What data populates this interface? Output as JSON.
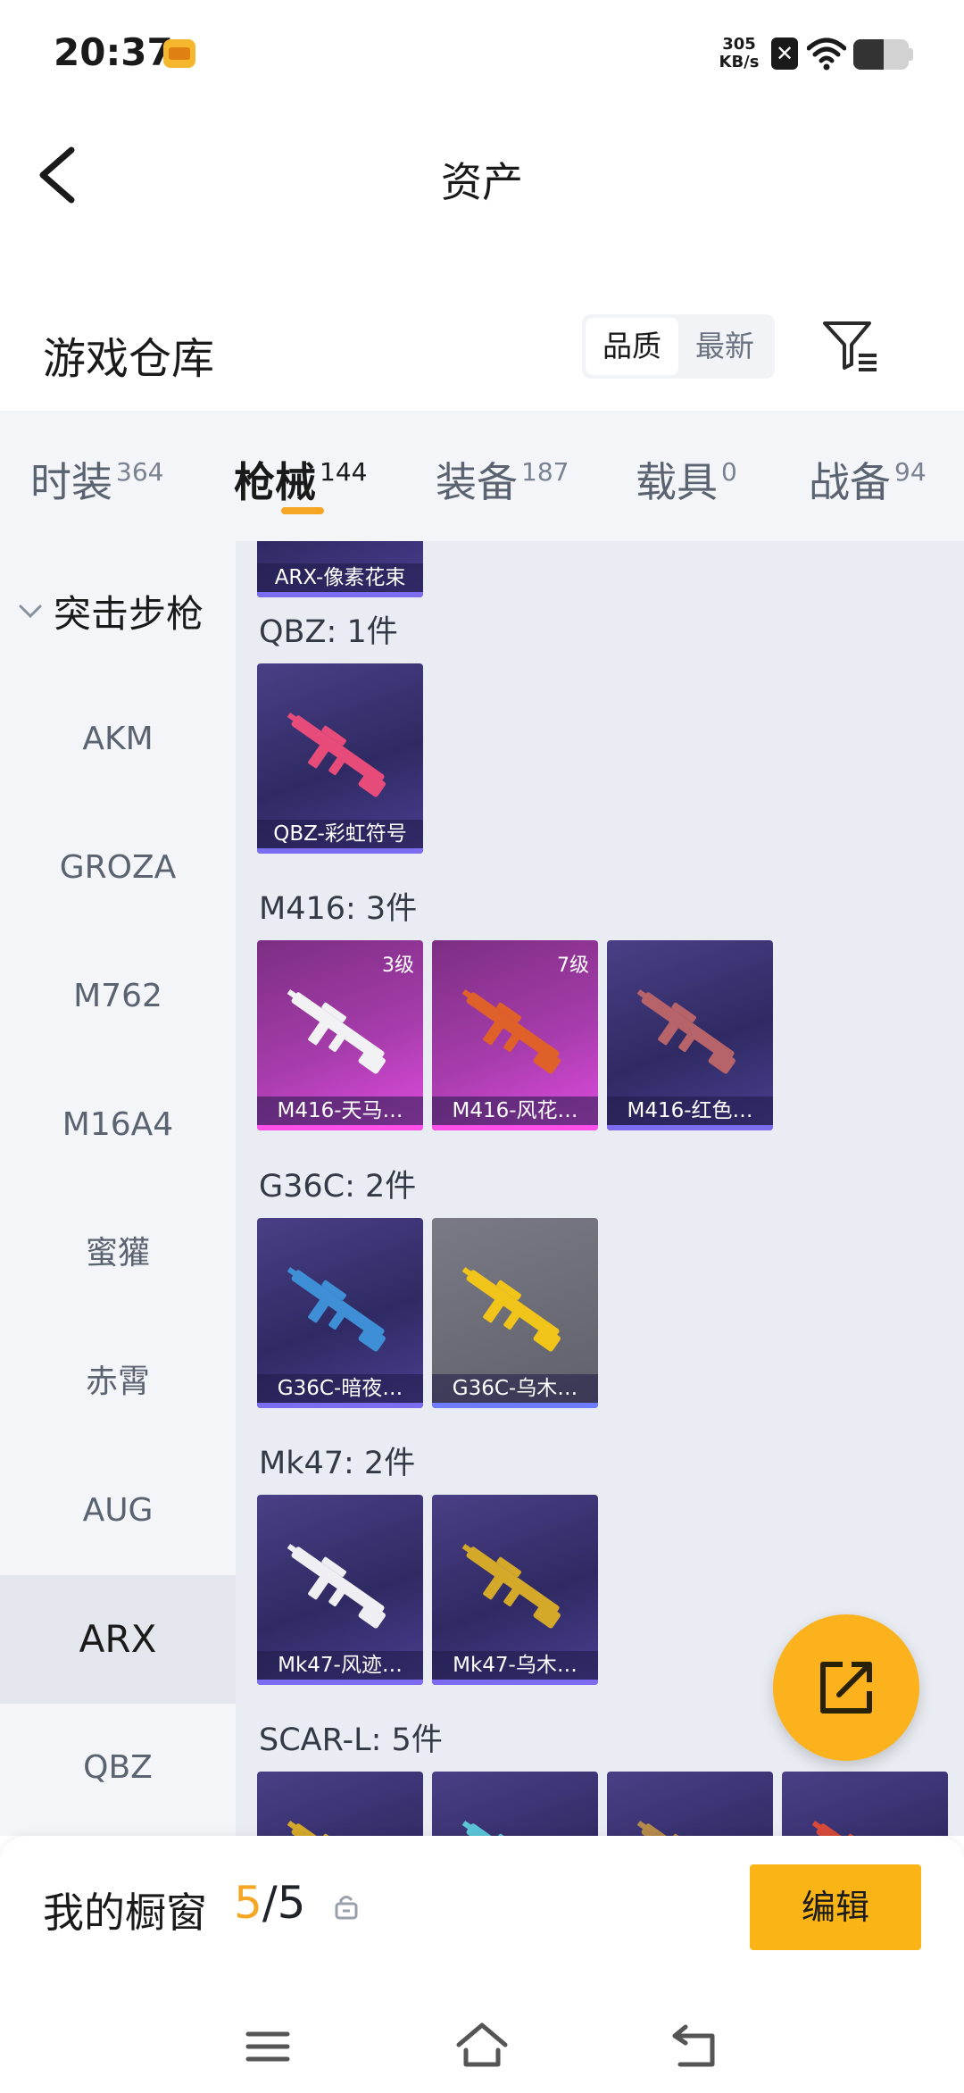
{
  "status_bar": {
    "time": "20:37",
    "net_speed_value": "305",
    "net_speed_unit": "KB/s",
    "battery_level": 0.55
  },
  "header": {
    "title": "资产"
  },
  "warehouse": {
    "title": "游戏仓库",
    "sort_options": [
      "品质",
      "最新"
    ],
    "sort_active": "品质"
  },
  "tabs": [
    {
      "label": "时装",
      "count": "364",
      "active": false
    },
    {
      "label": "枪械",
      "count": "144",
      "active": true
    },
    {
      "label": "装备",
      "count": "187",
      "active": false
    },
    {
      "label": "载具",
      "count": "0",
      "active": false
    },
    {
      "label": "战备",
      "count": "94",
      "active": false
    }
  ],
  "sidebar": {
    "group": "突击步枪",
    "items": [
      "AKM",
      "GROZA",
      "M762",
      "M16A4",
      "蜜獾",
      "赤霄",
      "AUG",
      "ARX",
      "QBZ"
    ],
    "active": "ARX"
  },
  "content": {
    "partial_card": "ARX-像素花束",
    "groups": [
      {
        "title": "QBZ: 1件",
        "items": [
          {
            "name": "QBZ-彩虹符号",
            "level": "",
            "style": "purple",
            "gun_color": "#e64b7a"
          }
        ]
      },
      {
        "title": "M416: 3件",
        "items": [
          {
            "name": "M416-天马…",
            "level": "3级",
            "style": "pink",
            "gun_color": "#f2f2f5"
          },
          {
            "name": "M416-风花…",
            "level": "7级",
            "style": "pink",
            "gun_color": "#e0602a"
          },
          {
            "name": "M416-红色…",
            "level": "",
            "style": "purple",
            "gun_color": "#b7636a"
          }
        ]
      },
      {
        "title": "G36C: 2件",
        "items": [
          {
            "name": "G36C-暗夜…",
            "level": "",
            "style": "purple",
            "gun_color": "#3f8fd6"
          },
          {
            "name": "G36C-乌木…",
            "level": "",
            "style": "gray",
            "gun_color": "#f0c419"
          }
        ]
      },
      {
        "title": "Mk47: 2件",
        "items": [
          {
            "name": "Mk47-风迹…",
            "level": "",
            "style": "purple",
            "gun_color": "#eeeef3"
          },
          {
            "name": "Mk47-乌木…",
            "level": "",
            "style": "purple",
            "gun_color": "#d4a92a"
          }
        ]
      },
      {
        "title": "SCAR-L: 5件",
        "items": [
          {
            "name": "",
            "level": "",
            "style": "purple",
            "gun_color": "#d4a92a"
          },
          {
            "name": "",
            "level": "",
            "style": "purple",
            "gun_color": "#5ac4d6"
          },
          {
            "name": "",
            "level": "",
            "style": "purple",
            "gun_color": "#b58a4a"
          },
          {
            "name": "",
            "level": "",
            "style": "purple",
            "gun_color": "#d64a3a"
          }
        ]
      }
    ]
  },
  "showcase": {
    "title": "我的橱窗",
    "count_current": "5",
    "count_sep_total": "/5",
    "edit_label": "编辑"
  },
  "colors": {
    "accent": "#f5a623",
    "button": "#fbb415"
  }
}
